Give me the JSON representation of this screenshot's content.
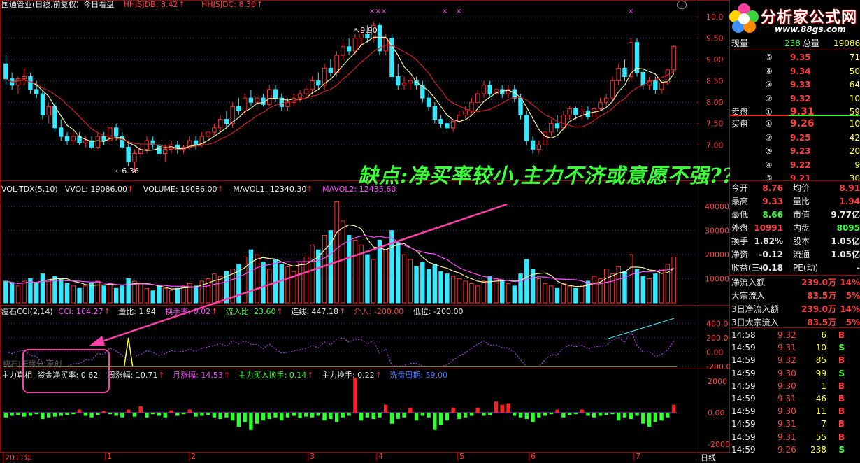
{
  "header": {
    "stock": "国通管业(日线,前复权)",
    "view": "今日看盘",
    "hhjsjdb_label": "HHJSJDB:",
    "hhjsjdb_val": "8.42",
    "hhjsjdc_label": "HHJSJDC:",
    "hhjsjdc_val": "8.30",
    "marks": "×××",
    "peak_price": "9.90",
    "low_price": "6.36"
  },
  "price_axis": [
    "10.0",
    "9.50",
    "9.00",
    "8.50",
    "8.00",
    "7.50",
    "7.00"
  ],
  "vol_header": {
    "name": "VOL-TDX(5,10)",
    "vvol": "VVOL: 19086.00",
    "volume": "VOLUME: 19086.00",
    "mavol1": "MAVOL1: 12340.30",
    "mavol2": "MAVOL2: 12435.60"
  },
  "vol_axis": [
    "40000",
    "30000",
    "20000",
    "10000"
  ],
  "cci_header": {
    "name": "瘦石CCI(2,14)",
    "cci": "CCI: 164.27",
    "liangbi": "量比: 1.94",
    "huanshou": "换手率: 0.02",
    "liurubi": "流入比: 23.60",
    "lianxian": "连线: 447.18",
    "jieru": "介入: -200.00",
    "diwei": "低位: -200.00"
  },
  "cci_axis": [
    "400.0",
    "200.0",
    "0.00",
    "-200.0"
  ],
  "cci_watermark": "瘦石|无缘分|原创",
  "flow_header": {
    "name": "主力真相",
    "zijin": "资金净买率: 0.62",
    "zhouzhang": "周涨幅: 10.71",
    "yuezhang": "月涨幅: 14.53",
    "mairu": "主力买入换手: 0.14",
    "huanshou": "主力换手: 0.22",
    "xipan": "洗盘周期: 59.00"
  },
  "flow_axis": [
    "2000",
    "0.00",
    "-2000"
  ],
  "date_axis": [
    "2011年",
    "1",
    "2",
    "3",
    "4",
    "5",
    "6",
    "7",
    "8",
    "9"
  ],
  "period_label": "日线",
  "annotation": "缺点:净买率较小,主力不济或意愿不强??",
  "logo": {
    "name": "分析家公式网",
    "url": "www.88gs.com"
  },
  "panel": {
    "top": [
      {
        "label": "现量",
        "value": "238",
        "label2": "总量",
        "value2": "19086"
      }
    ],
    "asks": [
      {
        "level": "⑤",
        "price": "9.35",
        "vol": "71"
      },
      {
        "level": "④",
        "price": "9.34",
        "vol": "50"
      },
      {
        "level": "③",
        "price": "9.33",
        "vol": "64"
      },
      {
        "level": "②",
        "price": "9.32",
        "vol": "10"
      },
      {
        "level": "①",
        "price": "9.31",
        "vol": "59",
        "label": "卖盘"
      }
    ],
    "bids": [
      {
        "level": "①",
        "price": "9.26",
        "vol": "10",
        "label": "买盘"
      },
      {
        "level": "②",
        "price": "9.25",
        "vol": "42"
      },
      {
        "level": "③",
        "price": "9.23",
        "vol": "20"
      },
      {
        "level": "④",
        "price": "9.22",
        "vol": "9"
      },
      {
        "level": "⑤",
        "price": "9.21",
        "vol": "30"
      }
    ],
    "stats": [
      {
        "l1": "今开",
        "v1": "8.76",
        "l2": "均价",
        "v2": "8.91"
      },
      {
        "l1": "最高",
        "v1": "9.33",
        "l2": "量比",
        "v2": "1.94"
      },
      {
        "l1": "最低",
        "v1": "8.66",
        "l2": "市值",
        "v2": "9.77亿"
      },
      {
        "l1": "外盘",
        "v1": "10991",
        "l2": "内盘",
        "v2": "8095"
      },
      {
        "l1": "换手",
        "v1": "1.82%",
        "l2": "股本",
        "v2": "1.05亿"
      },
      {
        "l1": "净资",
        "v1": "-0.12",
        "l2": "流通",
        "v2": "1.05亿"
      },
      {
        "l1": "收益(三)",
        "v1": "-0.18",
        "l2": "PE(动)",
        "v2": "-"
      }
    ],
    "flows": [
      {
        "label": "净流入额",
        "value": "239.0万",
        "pct": "14%"
      },
      {
        "label": "大宗流入",
        "value": "83.5万",
        "pct": "5%"
      },
      {
        "label": "3日净流入额",
        "value": "239.0万",
        "pct": "14%"
      },
      {
        "label": "3日大宗流入",
        "value": "83.5万",
        "pct": "5%"
      }
    ],
    "ticks": [
      {
        "t": "14:58",
        "p": "9.32",
        "v": "6",
        "s": "B"
      },
      {
        "t": "14:59",
        "p": "9.31",
        "v": "10",
        "s": "S"
      },
      {
        "t": "14:59",
        "p": "9.32",
        "v": "85",
        "s": "B"
      },
      {
        "t": "14:59",
        "p": "9.30",
        "v": "99",
        "s": "S"
      },
      {
        "t": "14:59",
        "p": "9.30",
        "v": "1",
        "s": "B"
      },
      {
        "t": "14:59",
        "p": "9.31",
        "v": "46",
        "s": "B"
      },
      {
        "t": "14:59",
        "p": "9.30",
        "v": "11",
        "s": "B"
      },
      {
        "t": "14:59",
        "p": "9.31",
        "v": "7",
        "s": "B"
      },
      {
        "t": "14:59",
        "p": "9.31",
        "v": "55",
        "s": "B"
      },
      {
        "t": "14:59",
        "p": "9.26",
        "v": "238",
        "s": "S"
      }
    ]
  },
  "colors": {
    "up": "#ff3030",
    "down": "#35e8ff",
    "ma5": "#f0f0a0",
    "ma10": "#d02020"
  },
  "chart_data": {
    "type": "candlestick",
    "ohlc": [
      [
        8.9,
        9.1,
        8.4,
        8.55
      ],
      [
        8.55,
        8.7,
        8.3,
        8.4
      ],
      [
        8.4,
        8.6,
        8.2,
        8.55
      ],
      [
        8.55,
        8.8,
        8.4,
        8.6
      ],
      [
        8.6,
        8.7,
        8.2,
        8.3
      ],
      [
        8.3,
        8.5,
        8.1,
        8.2
      ],
      [
        8.2,
        8.3,
        7.6,
        7.7
      ],
      [
        7.7,
        8.0,
        7.5,
        7.9
      ],
      [
        7.9,
        8.0,
        7.3,
        7.4
      ],
      [
        7.4,
        7.6,
        7.1,
        7.2
      ],
      [
        7.2,
        7.3,
        7.0,
        7.1
      ],
      [
        7.1,
        7.3,
        7.0,
        7.2
      ],
      [
        7.2,
        7.3,
        7.0,
        7.05
      ],
      [
        7.05,
        7.2,
        6.95,
        7.1
      ],
      [
        7.1,
        7.2,
        6.9,
        6.95
      ],
      [
        6.95,
        7.3,
        6.9,
        7.2
      ],
      [
        7.2,
        7.3,
        7.0,
        7.1
      ],
      [
        7.1,
        7.5,
        7.0,
        7.4
      ],
      [
        7.4,
        7.5,
        7.1,
        7.2
      ],
      [
        7.2,
        7.3,
        6.9,
        6.95
      ],
      [
        6.95,
        7.1,
        6.5,
        6.6
      ],
      [
        6.6,
        6.9,
        6.36,
        6.8
      ],
      [
        6.8,
        7.0,
        6.7,
        6.9
      ],
      [
        6.9,
        7.2,
        6.8,
        7.1
      ],
      [
        7.1,
        7.2,
        6.9,
        7.0
      ],
      [
        7.0,
        7.1,
        6.7,
        6.8
      ],
      [
        6.8,
        7.0,
        6.6,
        6.9
      ],
      [
        6.9,
        7.1,
        6.8,
        7.0
      ],
      [
        7.0,
        7.1,
        6.8,
        6.9
      ],
      [
        6.9,
        7.0,
        6.8,
        6.95
      ],
      [
        6.95,
        7.2,
        6.9,
        7.1
      ],
      [
        7.1,
        7.2,
        6.9,
        7.0
      ],
      [
        7.0,
        7.3,
        6.95,
        7.2
      ],
      [
        7.2,
        7.4,
        7.1,
        7.3
      ],
      [
        7.3,
        7.5,
        7.2,
        7.4
      ],
      [
        7.4,
        7.7,
        7.3,
        7.6
      ],
      [
        7.6,
        7.8,
        7.4,
        7.5
      ],
      [
        7.5,
        8.0,
        7.4,
        7.9
      ],
      [
        7.9,
        8.1,
        7.7,
        7.8
      ],
      [
        7.8,
        8.2,
        7.7,
        8.1
      ],
      [
        8.1,
        8.3,
        7.9,
        8.0
      ],
      [
        8.0,
        8.2,
        7.8,
        8.1
      ],
      [
        8.1,
        8.2,
        7.9,
        7.95
      ],
      [
        7.95,
        8.4,
        7.9,
        8.3
      ],
      [
        8.3,
        8.4,
        8.0,
        8.1
      ],
      [
        8.1,
        8.2,
        7.8,
        7.9
      ],
      [
        7.9,
        8.1,
        7.8,
        8.0
      ],
      [
        8.0,
        8.2,
        7.9,
        8.1
      ],
      [
        8.1,
        8.3,
        8.0,
        8.2
      ],
      [
        8.2,
        8.4,
        8.1,
        8.3
      ],
      [
        8.3,
        8.6,
        8.2,
        8.5
      ],
      [
        8.5,
        8.7,
        8.3,
        8.4
      ],
      [
        8.4,
        8.9,
        8.3,
        8.8
      ],
      [
        8.8,
        9.0,
        8.6,
        8.7
      ],
      [
        8.7,
        9.2,
        8.6,
        9.1
      ],
      [
        9.1,
        9.4,
        9.0,
        9.3
      ],
      [
        9.3,
        9.5,
        9.1,
        9.2
      ],
      [
        9.2,
        9.6,
        9.1,
        9.5
      ],
      [
        9.5,
        9.7,
        9.3,
        9.6
      ],
      [
        9.6,
        9.8,
        9.4,
        9.5
      ],
      [
        9.5,
        9.9,
        9.4,
        9.8
      ],
      [
        9.8,
        9.85,
        9.1,
        9.2
      ],
      [
        9.2,
        9.6,
        9.1,
        9.5
      ],
      [
        9.5,
        9.6,
        8.5,
        8.6
      ],
      [
        8.6,
        8.9,
        8.3,
        8.4
      ],
      [
        8.4,
        8.6,
        8.3,
        8.45
      ],
      [
        8.45,
        8.6,
        8.3,
        8.5
      ],
      [
        8.5,
        8.6,
        8.3,
        8.4
      ],
      [
        8.4,
        8.5,
        8.0,
        8.1
      ],
      [
        8.1,
        8.2,
        7.8,
        7.9
      ],
      [
        7.9,
        8.0,
        7.5,
        7.6
      ],
      [
        7.6,
        7.7,
        7.4,
        7.5
      ],
      [
        7.5,
        7.7,
        7.3,
        7.4
      ],
      [
        7.4,
        7.6,
        7.3,
        7.55
      ],
      [
        7.55,
        7.8,
        7.5,
        7.7
      ],
      [
        7.7,
        7.9,
        7.6,
        7.8
      ],
      [
        7.8,
        8.1,
        7.7,
        8.0
      ],
      [
        8.0,
        8.3,
        7.9,
        8.2
      ],
      [
        8.2,
        8.5,
        8.1,
        8.4
      ],
      [
        8.4,
        8.5,
        8.1,
        8.2
      ],
      [
        8.2,
        8.4,
        8.1,
        8.3
      ],
      [
        8.3,
        8.4,
        8.1,
        8.2
      ],
      [
        8.2,
        8.4,
        8.1,
        8.3
      ],
      [
        8.3,
        8.4,
        8.0,
        8.1
      ],
      [
        8.1,
        8.2,
        7.6,
        7.7
      ],
      [
        7.7,
        7.8,
        7.0,
        7.1
      ],
      [
        7.1,
        7.2,
        6.8,
        6.9
      ],
      [
        6.9,
        7.1,
        6.8,
        7.0
      ],
      [
        7.0,
        7.4,
        6.95,
        7.3
      ],
      [
        7.3,
        7.6,
        7.2,
        7.5
      ],
      [
        7.5,
        7.7,
        7.3,
        7.4
      ],
      [
        7.4,
        7.8,
        7.35,
        7.7
      ],
      [
        7.7,
        7.9,
        7.6,
        7.85
      ],
      [
        7.85,
        7.9,
        7.6,
        7.7
      ],
      [
        7.7,
        7.9,
        7.6,
        7.8
      ],
      [
        7.8,
        7.9,
        7.6,
        7.65
      ],
      [
        7.65,
        7.9,
        7.6,
        7.85
      ],
      [
        7.85,
        8.1,
        7.8,
        8.0
      ],
      [
        8.0,
        8.2,
        7.9,
        8.1
      ],
      [
        8.1,
        8.6,
        8.0,
        8.5
      ],
      [
        8.5,
        8.9,
        8.4,
        8.8
      ],
      [
        8.8,
        9.0,
        8.5,
        8.6
      ],
      [
        8.6,
        9.5,
        8.5,
        9.4
      ],
      [
        9.4,
        9.5,
        8.6,
        8.7
      ],
      [
        8.7,
        8.8,
        8.3,
        8.4
      ],
      [
        8.4,
        8.6,
        8.3,
        8.5
      ],
      [
        8.5,
        8.6,
        8.2,
        8.3
      ],
      [
        8.3,
        8.5,
        8.2,
        8.45
      ],
      [
        8.45,
        8.8,
        8.4,
        8.76
      ],
      [
        8.76,
        9.33,
        8.66,
        9.31
      ]
    ],
    "volume": [
      9,
      8,
      7,
      9,
      10,
      8,
      12,
      9,
      11,
      10,
      8,
      7,
      6,
      7,
      8,
      9,
      7,
      8,
      6,
      7,
      10,
      9,
      8,
      6,
      5,
      7,
      6,
      5,
      6,
      7,
      8,
      7,
      9,
      10,
      12,
      11,
      13,
      14,
      16,
      19,
      22,
      20,
      17,
      14,
      18,
      16,
      15,
      13,
      17,
      19,
      24,
      22,
      28,
      30,
      42,
      34,
      28,
      26,
      24,
      20,
      18,
      26,
      22,
      30,
      25,
      20,
      18,
      15,
      17,
      14,
      16,
      13,
      12,
      11,
      10,
      9,
      8,
      7,
      9,
      11,
      10,
      9,
      8,
      7,
      12,
      18,
      14,
      10,
      8,
      7,
      6,
      8,
      7,
      6,
      7,
      9,
      11,
      10,
      14,
      12,
      15,
      13,
      20,
      14,
      11,
      10,
      12,
      14,
      16,
      19
    ],
    "flow": [
      -300,
      -200,
      -150,
      -250,
      -200,
      -100,
      -400,
      -300,
      -250,
      -200,
      -150,
      -100,
      200,
      -200,
      -300,
      -150,
      100,
      -100,
      -200,
      -300,
      200,
      -250,
      400,
      -300,
      -100,
      -200,
      -300,
      150,
      -200,
      -100,
      200,
      -250,
      -200,
      -150,
      -300,
      -400,
      -300,
      -500,
      -900,
      -600,
      -1100,
      -700,
      -500,
      -400,
      -300,
      -500,
      -300,
      -200,
      -350,
      -250,
      -300,
      -200,
      -500,
      -400,
      -600,
      -300,
      -200,
      2200,
      -500,
      -300,
      -400,
      -300,
      500,
      -700,
      -400,
      -300,
      300,
      -500,
      -200,
      -300,
      -1100,
      -800,
      -500,
      300,
      -400,
      -300,
      -200,
      300,
      -200,
      -150,
      700,
      500,
      600,
      -200,
      -300,
      -400,
      -600,
      -300,
      -200,
      -100,
      200,
      -300,
      -150,
      -100,
      200,
      -200,
      -300,
      -200,
      -150,
      -100,
      -500,
      -300,
      -400,
      -200,
      -700,
      -900,
      -600,
      -500,
      -300,
      500
    ],
    "cci_range": [
      -200,
      500
    ],
    "price_range": [
      6.3,
      10.1
    ]
  }
}
